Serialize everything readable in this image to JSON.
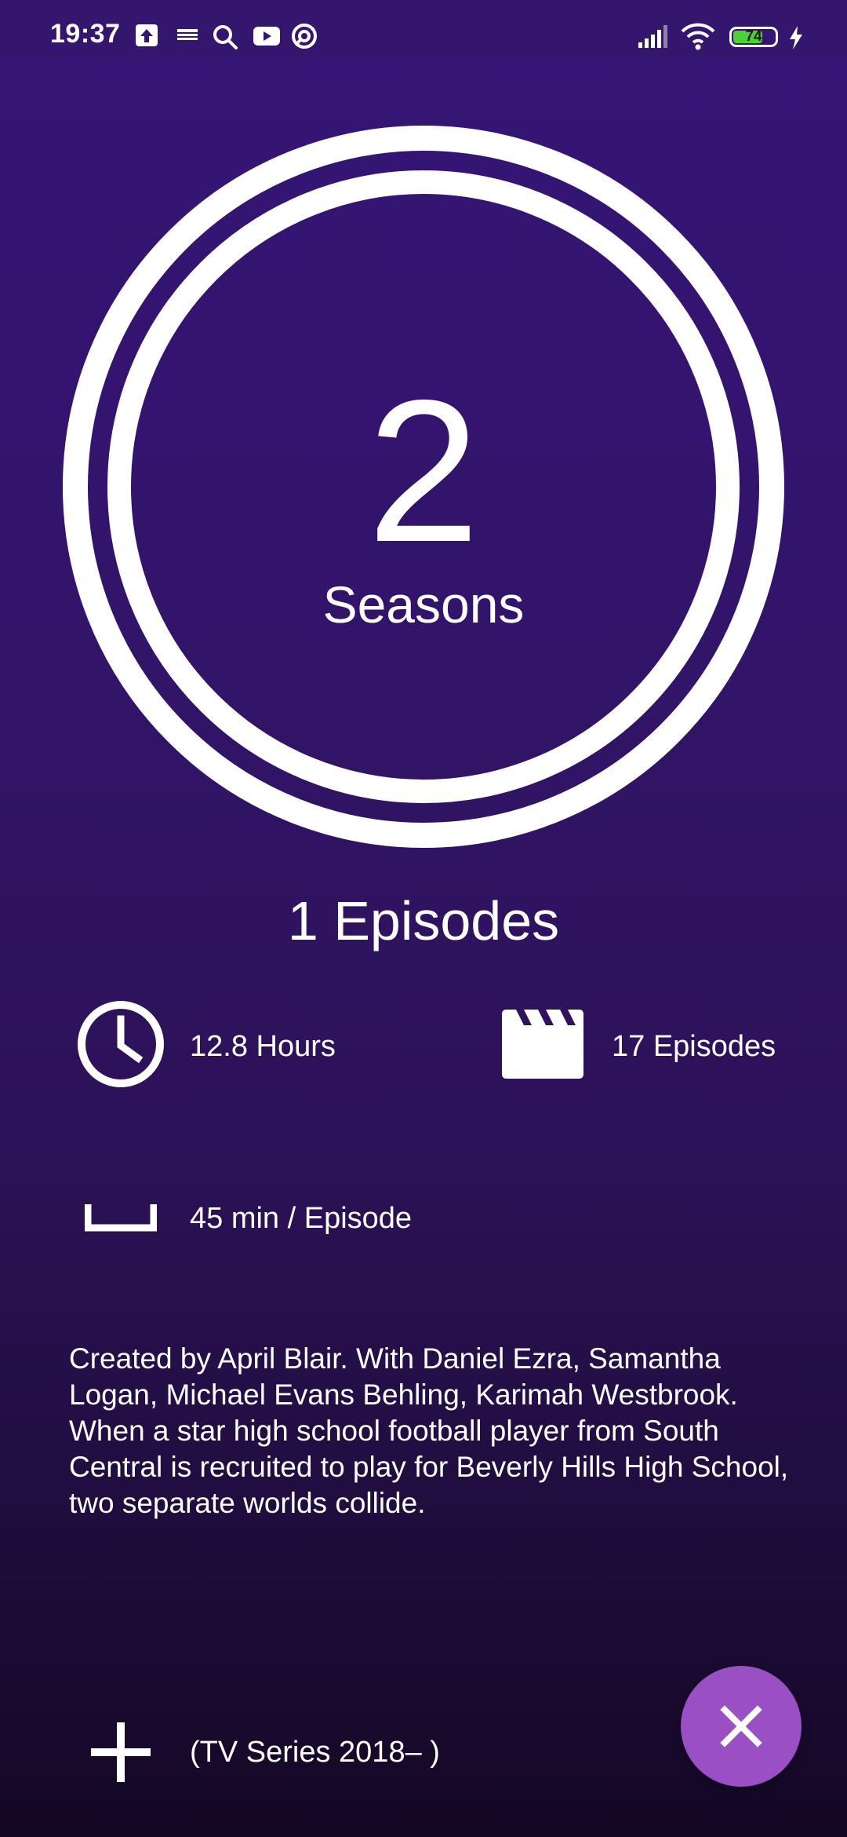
{
  "status_bar": {
    "time": "19:37",
    "battery": "74",
    "battery_level": 0.74,
    "icons": [
      "upload-icon",
      "news-icon",
      "search-icon",
      "youtube-icon",
      "vpn-icon",
      "signal-icon",
      "wifi-icon",
      "battery-icon",
      "charging-icon"
    ]
  },
  "hero": {
    "season_count": "2",
    "season_label": "Seasons"
  },
  "episodes_heading": "1 Episodes",
  "stats": {
    "hours": "12.8 Hours",
    "episodes": "17 Episodes",
    "runtime": "45 min / Episode"
  },
  "description": "Created by April Blair.  With Daniel Ezra, Samantha Logan, Michael Evans Behling, Karimah Westbrook. When a star high school football player from South Central is recruited to play for Beverly Hills High School, two separate worlds collide.",
  "footer": {
    "series_info": "(TV Series 2018– )"
  },
  "colors": {
    "background": "#361577",
    "fab": "#9a4fc4",
    "battery": "#4cd137"
  }
}
